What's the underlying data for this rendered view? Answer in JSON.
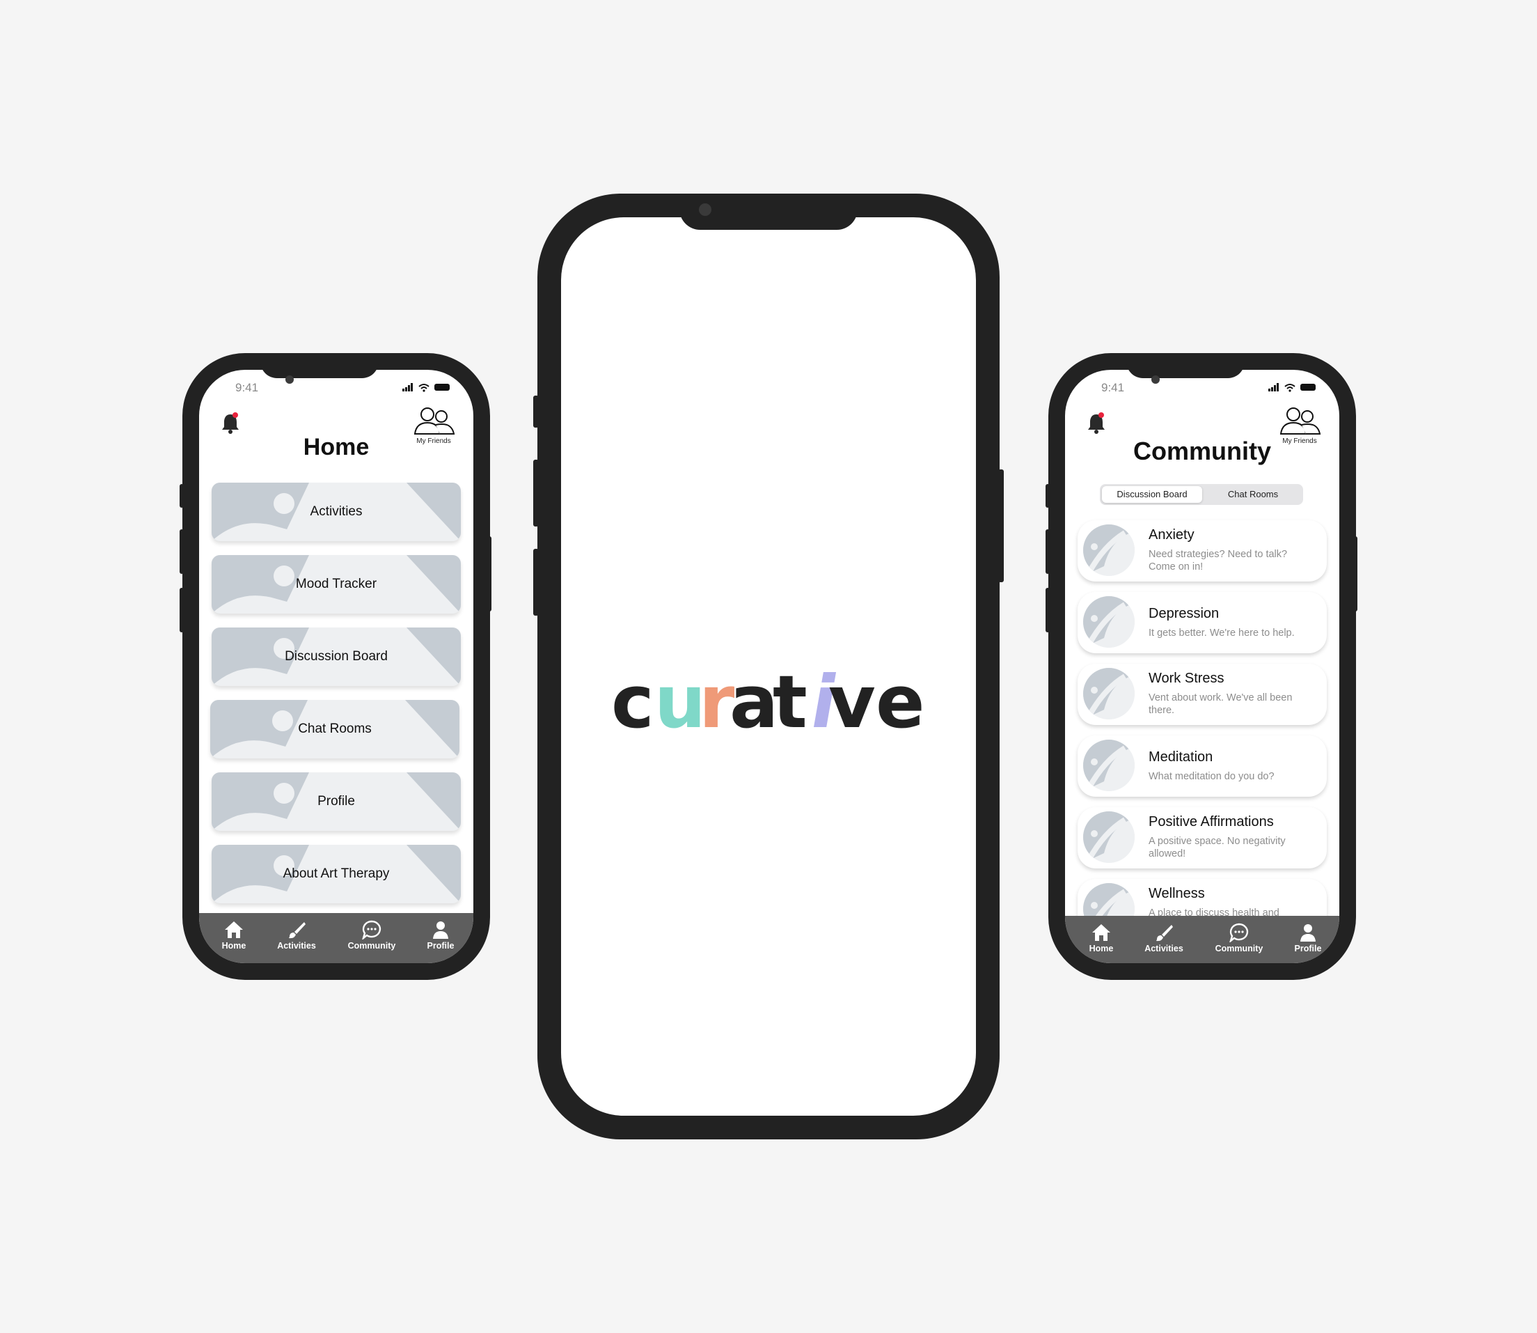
{
  "colors": {
    "background": "#f5f5f5",
    "device": "#222222",
    "tab_bar": "#5e5e5e",
    "placeholder": "#c5ccd3",
    "placeholder_light": "#eef0f2",
    "notification_dot": "#e8233d",
    "logo_dark": "#222222",
    "logo_teal": "#7fd8c8",
    "logo_salmon": "#ef9a78",
    "logo_lavender": "#b1b0ec"
  },
  "status_bar": {
    "time": "9:41"
  },
  "header": {
    "friends_label": "My Friends"
  },
  "home": {
    "title": "Home",
    "items": [
      {
        "label": "Activities"
      },
      {
        "label": "Mood Tracker"
      },
      {
        "label": "Discussion Board"
      },
      {
        "label": "Chat Rooms"
      },
      {
        "label": "Profile"
      },
      {
        "label": "About Art Therapy"
      }
    ]
  },
  "splash": {
    "logo_letters": [
      "c",
      "u",
      "r",
      "a",
      "t",
      "i",
      "v",
      "e"
    ],
    "logo_text": "curative"
  },
  "community": {
    "title": "Community",
    "segments": {
      "active": "Discussion Board",
      "inactive": "Chat Rooms"
    },
    "topics": [
      {
        "title": "Anxiety",
        "desc": "Need strategies? Need to talk? Come on in!"
      },
      {
        "title": "Depression",
        "desc": "It gets better. We're here to help."
      },
      {
        "title": "Work Stress",
        "desc": "Vent about work. We've all been there."
      },
      {
        "title": "Meditation",
        "desc": "What meditation do you do?"
      },
      {
        "title": "Positive Affirmations",
        "desc": "A positive space. No negativity allowed!"
      },
      {
        "title": "Wellness",
        "desc": "A place to discuss health and"
      }
    ]
  },
  "tabbar": {
    "items": [
      {
        "label": "Home",
        "icon": "home-icon"
      },
      {
        "label": "Activities",
        "icon": "brush-icon"
      },
      {
        "label": "Community",
        "icon": "chat-bubble-icon"
      },
      {
        "label": "Profile",
        "icon": "person-icon"
      }
    ]
  }
}
